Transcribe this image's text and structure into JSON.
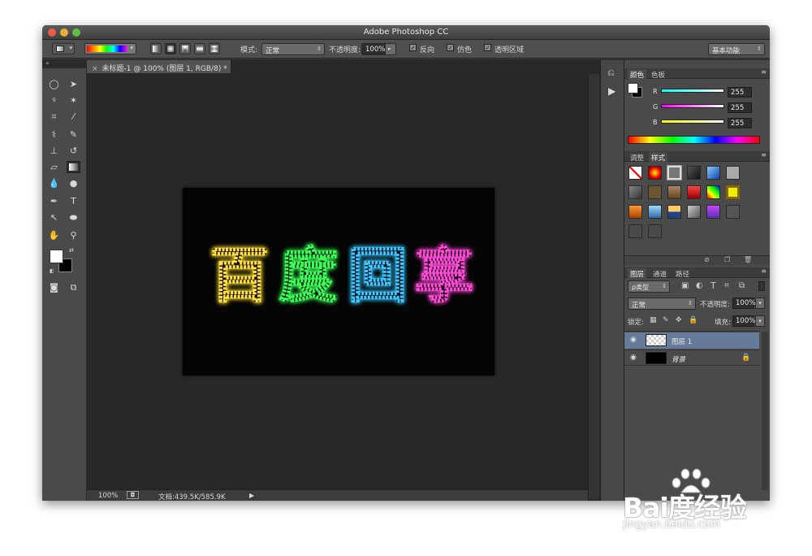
{
  "window": {
    "title": "Adobe Photoshop CC"
  },
  "options_bar": {
    "mode_label": "模式:",
    "mode_value": "正常",
    "opacity_label": "不透明度:",
    "opacity_value": "100%",
    "reverse_label": "反向",
    "dither_label": "仿色",
    "transparency_label": "透明区域",
    "workspace": "基本功能"
  },
  "document": {
    "tab_title": "未标题-1 @ 100% (图层 1, RGB/8) *",
    "canvas_text": [
      "百",
      "度",
      "回",
      "享"
    ],
    "glyph_colors": [
      "#ffe23a",
      "#3cff5a",
      "#3cc8ff",
      "#ff4bd8"
    ]
  },
  "status": {
    "zoom": "100%",
    "doc_size": "文档:439.5K/585.9K"
  },
  "color_panel": {
    "tabs": [
      "颜色",
      "色板"
    ],
    "channels": [
      {
        "label": "R",
        "value": "255"
      },
      {
        "label": "G",
        "value": "255"
      },
      {
        "label": "B",
        "value": "255"
      }
    ]
  },
  "styles_panel": {
    "tabs": [
      "调整",
      "样式"
    ]
  },
  "layers_panel": {
    "tabs": [
      "图层",
      "通道",
      "路径"
    ],
    "filter_label": "ρ类型",
    "blend_mode": "正常",
    "opacity_label": "不透明度:",
    "opacity_value": "100%",
    "lock_label": "锁定:",
    "fill_label": "填充:",
    "fill_value": "100%",
    "layers": [
      {
        "name": "图层 1",
        "selected": true
      },
      {
        "name": "背景",
        "selected": false
      }
    ]
  },
  "watermark": {
    "brand": "Bai度经验",
    "url": "jingyan.baidu.com"
  }
}
